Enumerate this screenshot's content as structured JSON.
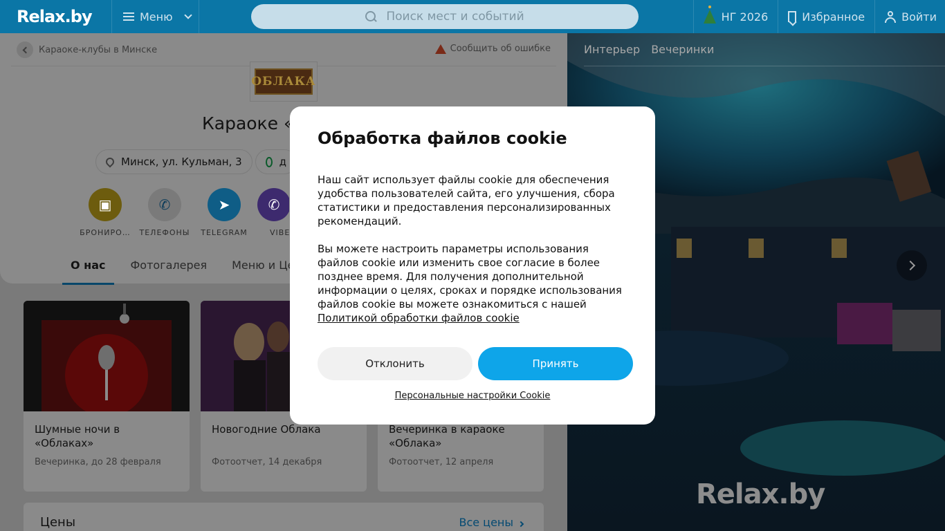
{
  "header": {
    "logo": "Relax.by",
    "menu_label": "Меню",
    "search_placeholder": "Поиск мест и событий",
    "ng_label": "НГ 2026",
    "favorites_label": "Избранное",
    "login_label": "Войти"
  },
  "breadcrumb": {
    "back_label": "Караоке-клубы в Минске",
    "report_label": "Сообщить об ошибке"
  },
  "venue": {
    "logo_text": "ОБЛАКА",
    "title": "Караоке «",
    "address": "Минск, ул. Кульман, 3",
    "hours": "д"
  },
  "actions": [
    {
      "label": "БРОНИРО…",
      "icon": "calendar-icon",
      "color": "#6d5c0e"
    },
    {
      "label": "ТЕЛЕФОНЫ",
      "icon": "phone-icon",
      "color": "#7a7a7a"
    },
    {
      "label": "TELEGRAM",
      "icon": "telegram-icon",
      "color": "#0f5d86"
    },
    {
      "label": "VIBE",
      "icon": "viber-icon",
      "color": "#3d2a6e"
    }
  ],
  "tabs": [
    "О нас",
    "Фотогалерея",
    "Меню и Цены"
  ],
  "posts": [
    {
      "title": "Шумные ночи в «Облаках»",
      "meta": "Вечеринка, до 28 февраля"
    },
    {
      "title": "Новогодние Облака",
      "meta": "Фотоотчет, 14 декабря"
    },
    {
      "title": "Вечеринка в караоке «Облака»",
      "meta": "Фотоотчет, 12 апреля"
    }
  ],
  "prices": {
    "title": "Цены",
    "all_link": "Все цены"
  },
  "gallery": {
    "tabs": [
      "Интерьер",
      "Вечеринки"
    ],
    "watermark": "Relax.by"
  },
  "cookie": {
    "title": "Обработка файлов cookie",
    "p1": "Наш сайт использует файлы cookie для обеспечения удобства пользователей сайта, его улучшения, сбора статистики и предоставления персонализированных рекомендаций.",
    "p2": "Вы можете настроить параметры использования файлов cookie или изменить свое согласие в более позднее время. Для получения дополнительной информации о целях, сроках и порядке использования файлов cookie вы можете ознакомиться с нашей",
    "policy_link": "Политикой обработки файлов cookie",
    "decline": "Отклонить",
    "accept": "Принять",
    "personal": "Персональные настройки Cookie"
  },
  "colors": {
    "header": "#0b76a6",
    "accept": "#0ea5e9",
    "decline": "#f1f1f1"
  }
}
